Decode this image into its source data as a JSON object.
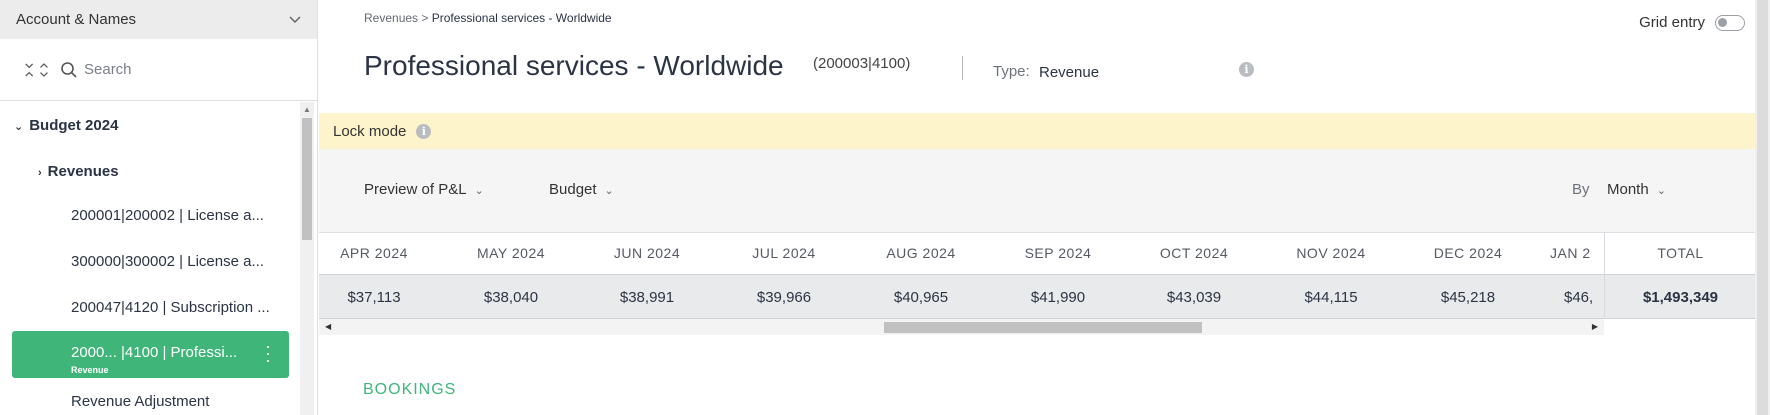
{
  "sidebar": {
    "account_selector": "Account & Names",
    "search_placeholder": "Search",
    "tree": {
      "budget_label": "Budget 2024",
      "revenues_label": "Revenues",
      "items": [
        "200001|200002 | License a...",
        "300000|300002 | License a...",
        "200047|4120 | Subscription ..."
      ],
      "selected_item": {
        "label": "2000... |4100 | Professi...",
        "sublabel": "Revenue"
      },
      "after_item": "Revenue Adjustment"
    }
  },
  "breadcrumb": {
    "parent": "Revenues",
    "separator": ">",
    "current": "Professional services - Worldwide"
  },
  "header": {
    "title": "Professional services - Worldwide",
    "code": "(200003|4100)",
    "type_label": "Type:",
    "type_value": "Revenue",
    "grid_entry_label": "Grid entry"
  },
  "lock_bar": {
    "label": "Lock mode"
  },
  "filters": {
    "view": "Preview of P&L",
    "scenario": "Budget",
    "by_label": "By",
    "by_value": "Month"
  },
  "table": {
    "months": [
      "APR 2024",
      "MAY 2024",
      "JUN 2024",
      "JUL 2024",
      "AUG 2024",
      "SEP 2024",
      "OCT 2024",
      "NOV 2024",
      "DEC 2024",
      "JAN 2"
    ],
    "values": [
      "$37,113",
      "$38,040",
      "$38,991",
      "$39,966",
      "$40,965",
      "$41,990",
      "$43,039",
      "$44,115",
      "$45,218",
      "$46,"
    ],
    "total_label": "TOTAL",
    "total_value": "$1,493,349"
  },
  "section": {
    "bookings": "BOOKINGS"
  },
  "colors": {
    "accent_green": "#3fb57a",
    "lock_bar_bg": "#fdf4cb"
  }
}
